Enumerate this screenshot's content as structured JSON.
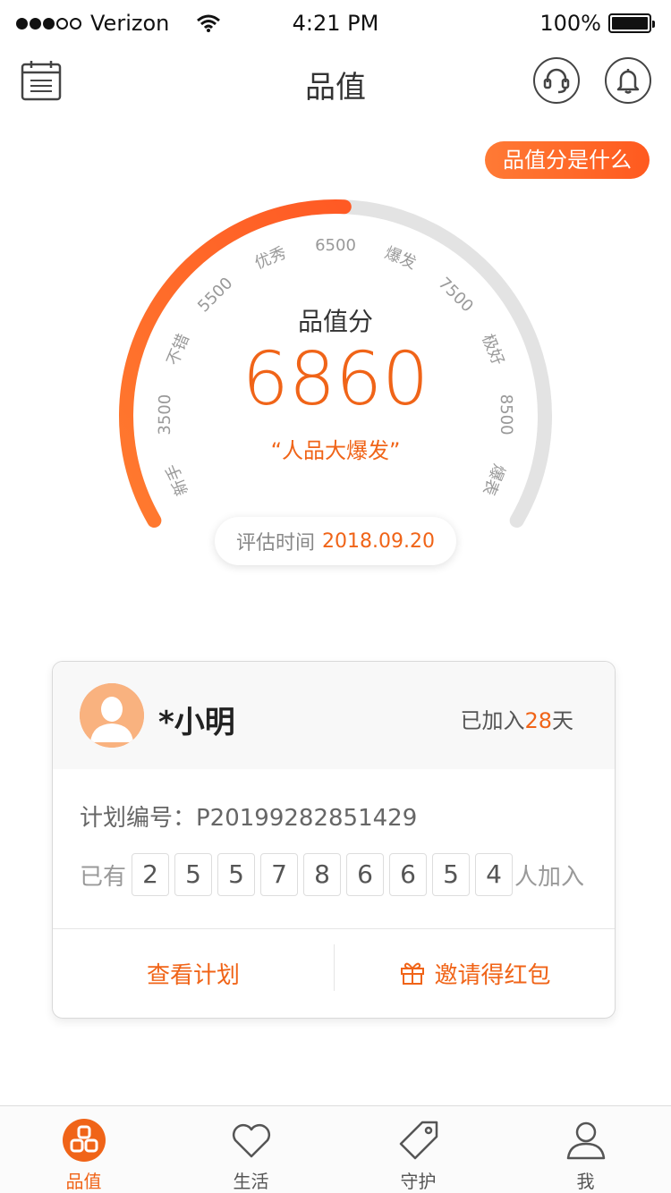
{
  "status_bar": {
    "carrier": "Verizon",
    "time": "4:21 PM",
    "battery": "100%"
  },
  "nav": {
    "title": "品值",
    "icons": [
      "calendar-icon",
      "customer-service-icon",
      "bell-icon"
    ]
  },
  "what_is_button": "品值分是什么",
  "gauge": {
    "title": "品值分",
    "score": "6860",
    "description": "“人品大爆发”",
    "evaluation_label": "评估时间",
    "evaluation_date": "2018.09.20",
    "labels": [
      "新手",
      "3500",
      "不错",
      "5500",
      "优秀",
      "6500",
      "爆发",
      "7500",
      "极好",
      "8500",
      "爆表"
    ],
    "progress_fraction": 0.51,
    "colors": {
      "progress": "#f06418",
      "track": "#e3e3e3"
    }
  },
  "card": {
    "user_name": "*小明",
    "joined_prefix": "已加入",
    "joined_days": "28",
    "joined_suffix": "天",
    "plan_number": "计划编号：P20199282851429",
    "counter_prefix": "已有",
    "counter_digits": [
      "2",
      "5",
      "5",
      "7",
      "8",
      "6",
      "6",
      "5",
      "4"
    ],
    "counter_suffix": "人加入",
    "actions": {
      "view_plan": "查看计划",
      "invite": "邀请得红包"
    }
  },
  "tabs": [
    {
      "label": "品值",
      "icon": "pinzhi-icon",
      "active": true
    },
    {
      "label": "生活",
      "icon": "heart-icon",
      "active": false
    },
    {
      "label": "守护",
      "icon": "tag-icon",
      "active": false
    },
    {
      "label": "我",
      "icon": "person-icon",
      "active": false
    }
  ],
  "accent_color": "#f06418"
}
